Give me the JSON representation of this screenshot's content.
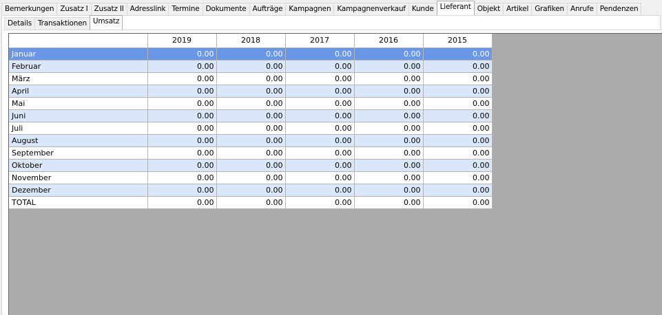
{
  "main_tabs": [
    {
      "label": "Bemerkungen",
      "active": false
    },
    {
      "label": "Zusatz I",
      "active": false
    },
    {
      "label": "Zusatz II",
      "active": false
    },
    {
      "label": "Adresslink",
      "active": false
    },
    {
      "label": "Termine",
      "active": false
    },
    {
      "label": "Dokumente",
      "active": false
    },
    {
      "label": "Aufträge",
      "active": false
    },
    {
      "label": "Kampagnen",
      "active": false
    },
    {
      "label": "Kampagnenverkauf",
      "active": false
    },
    {
      "label": "Kunde",
      "active": false
    },
    {
      "label": "Lieferant",
      "active": true
    },
    {
      "label": "Objekt",
      "active": false
    },
    {
      "label": "Artikel",
      "active": false
    },
    {
      "label": "Grafiken",
      "active": false
    },
    {
      "label": "Anrufe",
      "active": false
    },
    {
      "label": "Pendenzen",
      "active": false
    }
  ],
  "sub_tabs": [
    {
      "label": "Details",
      "active": false
    },
    {
      "label": "Transaktionen",
      "active": false
    },
    {
      "label": "Umsatz",
      "active": true
    }
  ],
  "table": {
    "columns": [
      "",
      "2019",
      "2018",
      "2017",
      "2016",
      "2015"
    ],
    "rows": [
      {
        "label": "Januar",
        "values": [
          "0.00",
          "0.00",
          "0.00",
          "0.00",
          "0.00"
        ],
        "selected": true
      },
      {
        "label": "Februar",
        "values": [
          "0.00",
          "0.00",
          "0.00",
          "0.00",
          "0.00"
        ]
      },
      {
        "label": "März",
        "values": [
          "0.00",
          "0.00",
          "0.00",
          "0.00",
          "0.00"
        ]
      },
      {
        "label": "April",
        "values": [
          "0.00",
          "0.00",
          "0.00",
          "0.00",
          "0.00"
        ]
      },
      {
        "label": "Mai",
        "values": [
          "0.00",
          "0.00",
          "0.00",
          "0.00",
          "0.00"
        ]
      },
      {
        "label": "Juni",
        "values": [
          "0.00",
          "0.00",
          "0.00",
          "0.00",
          "0.00"
        ]
      },
      {
        "label": "Juli",
        "values": [
          "0.00",
          "0.00",
          "0.00",
          "0.00",
          "0.00"
        ]
      },
      {
        "label": "August",
        "values": [
          "0.00",
          "0.00",
          "0.00",
          "0.00",
          "0.00"
        ]
      },
      {
        "label": "September",
        "values": [
          "0.00",
          "0.00",
          "0.00",
          "0.00",
          "0.00"
        ]
      },
      {
        "label": "Oktober",
        "values": [
          "0.00",
          "0.00",
          "0.00",
          "0.00",
          "0.00"
        ]
      },
      {
        "label": "November",
        "values": [
          "0.00",
          "0.00",
          "0.00",
          "0.00",
          "0.00"
        ]
      },
      {
        "label": "Dezember",
        "values": [
          "0.00",
          "0.00",
          "0.00",
          "0.00",
          "0.00"
        ]
      },
      {
        "label": "TOTAL",
        "values": [
          "0.00",
          "0.00",
          "0.00",
          "0.00",
          "0.00"
        ],
        "total": true
      }
    ]
  },
  "colors": {
    "selected_row": "#6a97e8",
    "alt_row": "#dbe7fb",
    "grid_background": "#ababab"
  }
}
